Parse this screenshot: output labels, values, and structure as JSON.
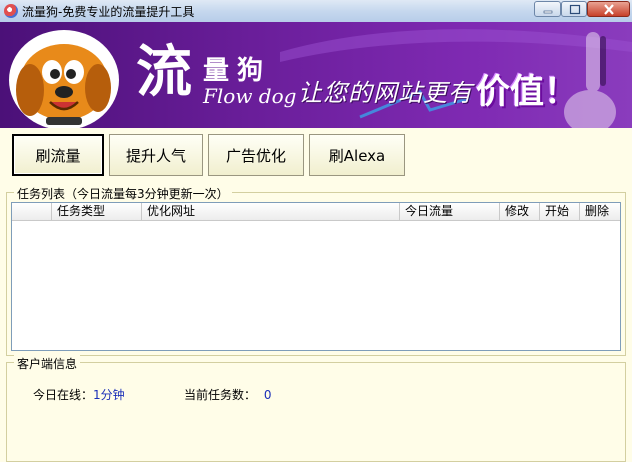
{
  "window": {
    "title": "流量狗-免费专业的流量提升工具"
  },
  "banner": {
    "logo_big": "流",
    "logo_small": "量狗",
    "logo_en": "Flow dog",
    "slogan": "让您的网站更有",
    "slogan_strong": "价值！"
  },
  "toolbar": {
    "buttons": [
      {
        "label": "刷流量"
      },
      {
        "label": "提升人气"
      },
      {
        "label": "广告优化"
      },
      {
        "label": "刷Alexa"
      }
    ]
  },
  "task_list": {
    "title": "任务列表（今日流量每3分钟更新一次）",
    "columns": [
      "",
      "任务类型",
      "优化网址",
      "今日流量",
      "修改",
      "开始",
      "删除"
    ],
    "rows": []
  },
  "client_info": {
    "title": "客户端信息",
    "online_label": "今日在线：",
    "online_value": "1分钟",
    "tasks_label": "当前任务数：",
    "tasks_value": "0"
  }
}
